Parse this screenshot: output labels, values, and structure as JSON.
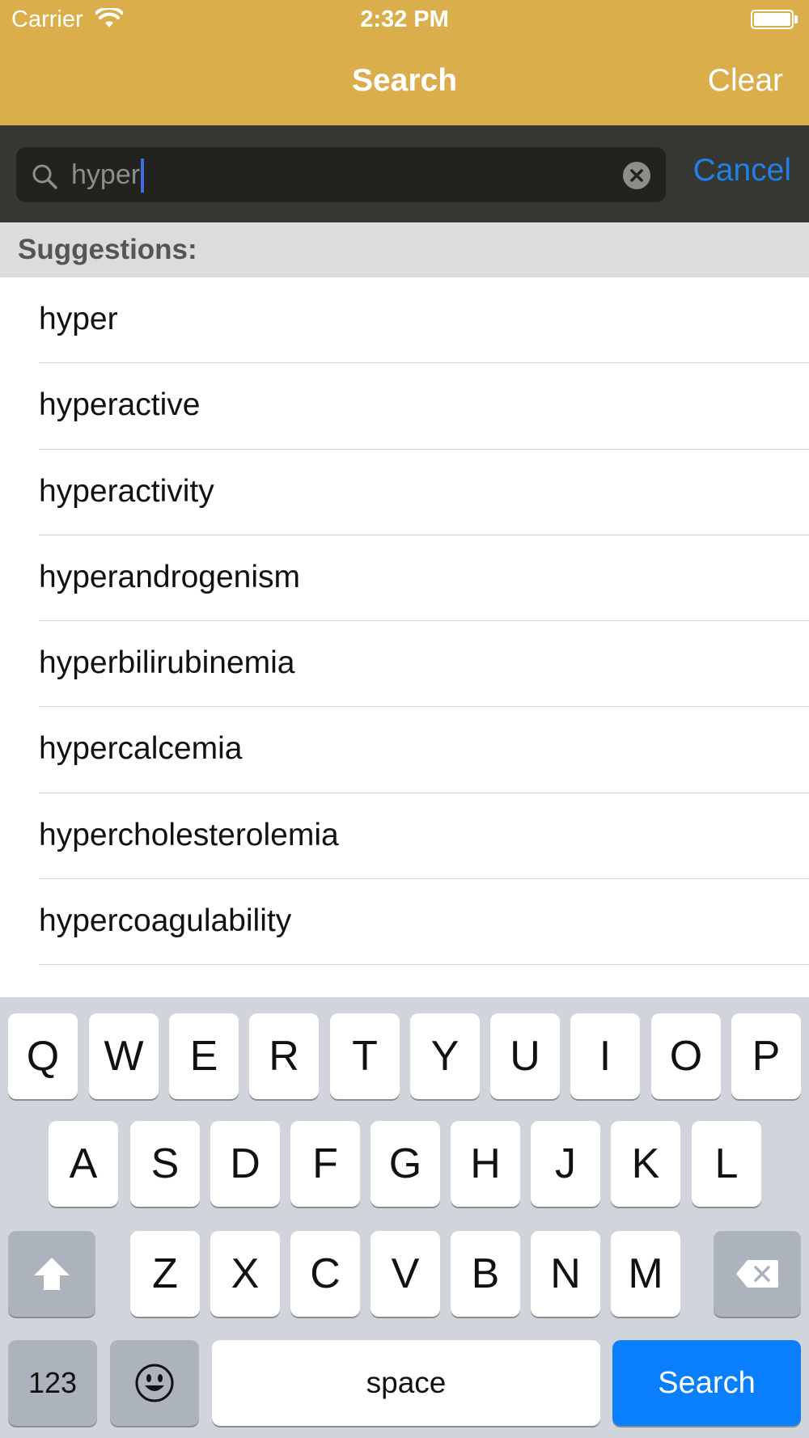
{
  "status_bar": {
    "carrier": "Carrier",
    "time": "2:32 PM",
    "wifi_icon": "wifi-icon",
    "battery_icon": "battery-icon"
  },
  "nav": {
    "title": "Search",
    "clear_label": "Clear"
  },
  "search": {
    "value": "hyper",
    "icon": "search-icon",
    "clear_icon": "clear-field-icon",
    "cancel_label": "Cancel"
  },
  "suggestions": {
    "header": "Suggestions:",
    "items": [
      "hyper",
      "hyperactive",
      "hyperactivity",
      "hyperandrogenism",
      "hyperbilirubinemia",
      "hypercalcemia",
      "hypercholesterolemia",
      "hypercoagulability"
    ]
  },
  "keyboard": {
    "row1": [
      "Q",
      "W",
      "E",
      "R",
      "T",
      "Y",
      "U",
      "I",
      "O",
      "P"
    ],
    "row2": [
      "A",
      "S",
      "D",
      "F",
      "G",
      "H",
      "J",
      "K",
      "L"
    ],
    "row3": [
      "Z",
      "X",
      "C",
      "V",
      "B",
      "N",
      "M"
    ],
    "numbers_label": "123",
    "space_label": "space",
    "search_label": "Search",
    "shift_icon": "shift-icon",
    "backspace_icon": "backspace-icon",
    "emoji_icon": "emoji-icon"
  },
  "colors": {
    "header_gold": "#dbae4c",
    "search_bar_bg": "#363632",
    "accent_blue": "#1f80e6",
    "keyboard_search_blue": "#0a7ffe"
  }
}
